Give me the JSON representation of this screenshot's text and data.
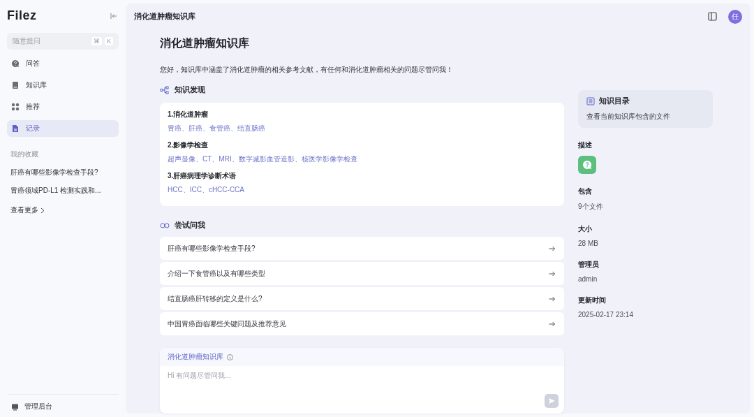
{
  "sidebar": {
    "logo": "Filez",
    "search": {
      "placeholder": "随意提问",
      "shortcut": [
        "⌘",
        "K"
      ]
    },
    "nav": [
      {
        "label": "问答",
        "selected": false
      },
      {
        "label": "知识库",
        "selected": false
      },
      {
        "label": "推荐",
        "selected": false
      },
      {
        "label": "记录",
        "selected": true
      }
    ],
    "favorites_heading": "我的收藏",
    "favorites": [
      "肝癌有哪些影像学检查手段?",
      "胃癌领域PD-L1 检测实践和..."
    ],
    "more": "查看更多",
    "footer": "管理后台"
  },
  "header": {
    "title": "消化道肿瘤知识库",
    "avatar": "任"
  },
  "content": {
    "title": "消化道肿瘤知识库",
    "intro": "您好，知识库中涵盖了消化道肿瘤的相关参考文献，有任何和消化道肿瘤相关的问题尽管问我！",
    "discovery": {
      "heading": "知识发现",
      "topics": [
        {
          "title": "1.消化道肿瘤",
          "terms": "胃癌、肝癌、食管癌、结直肠癌"
        },
        {
          "title": "2.影像学检查",
          "terms": "超声显像、CT、MRI、数字减影血管造影、核医学影像学检查"
        },
        {
          "title": "3.肝癌病理学诊断术语",
          "terms": "HCC、ICC、cHCC-CCA"
        }
      ]
    },
    "try": {
      "heading": "尝试问我",
      "questions": [
        "肝癌有哪些影像学检查手段?",
        "介绍一下食管癌以及有哪些类型",
        "结直肠癌肝转移的定义是什么?",
        "中国胃癌面临哪些关键问题及推荐意见"
      ]
    },
    "chat": {
      "scope": "消化道肿瘤知识库",
      "placeholder": "Hi 有问题尽管问我..."
    }
  },
  "info": {
    "catalog": {
      "title": "知识目录",
      "subtitle": "查看当前知识库包含的文件"
    },
    "fields": [
      {
        "label": "描述",
        "kind": "icon"
      },
      {
        "label": "包含",
        "kind": "text",
        "value": "9个文件"
      },
      {
        "label": "大小",
        "kind": "text",
        "value": "28 MB"
      },
      {
        "label": "管理员",
        "kind": "text",
        "value": "admin"
      },
      {
        "label": "更新时间",
        "kind": "text",
        "value": "2025-02-17 23:14"
      }
    ]
  }
}
